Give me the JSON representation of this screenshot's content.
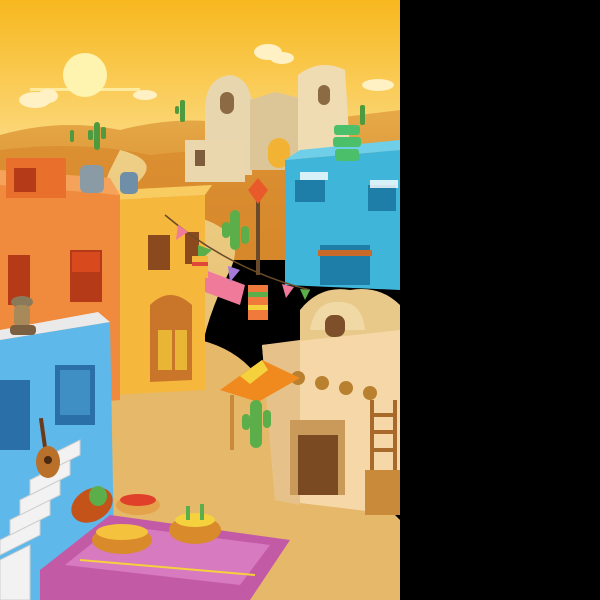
{
  "scene": {
    "palette": {
      "sky_top": "#f7b81f",
      "sky_bottom": "#fde39b",
      "sun": "#fff3b0",
      "dunes": "#d9892a",
      "dunes_light": "#e7a948",
      "road": "#e6b766",
      "orange_house": "#f08a3c",
      "yellow_house": "#f5b83d",
      "teal_house": "#3fb6d9",
      "blue_house": "#5fb8ea",
      "cream_house": "#f6d8a8",
      "rug": "#c35aa6",
      "cactus": "#5cae4a",
      "background": "#000000"
    },
    "icons": [
      "sun-icon",
      "cloud-icon",
      "cactus-icon",
      "guitar-icon",
      "sombrero-icon",
      "street-lamp-icon",
      "bunting-flag-icon",
      "market-umbrella-icon",
      "basket-icon",
      "clay-pot-icon",
      "ladder-icon"
    ]
  }
}
